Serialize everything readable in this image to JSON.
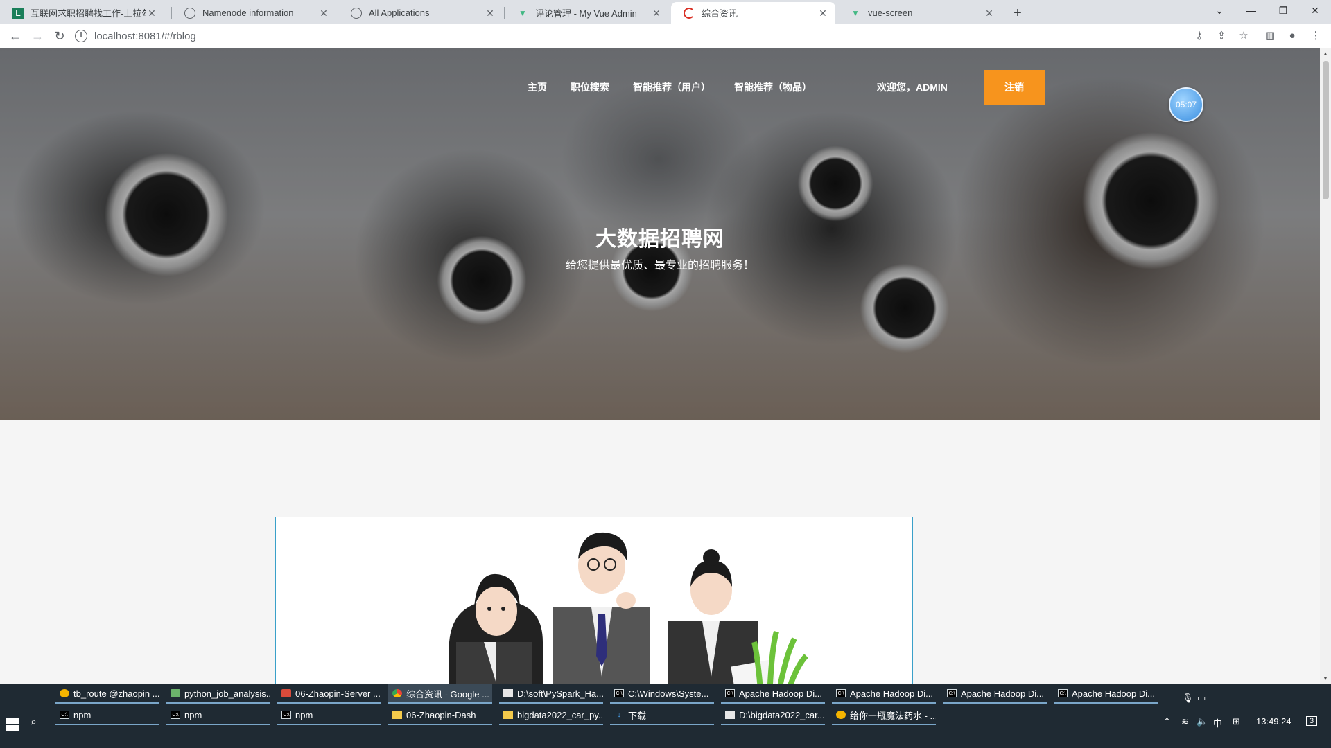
{
  "browser": {
    "tabs": [
      {
        "title": "互联网求职招聘找工作-上拉勾招",
        "favicon": "L",
        "active": false
      },
      {
        "title": "Namenode information",
        "favicon": "globe",
        "active": false
      },
      {
        "title": "All Applications",
        "favicon": "globe",
        "active": false
      },
      {
        "title": "评论管理 - My Vue Admin",
        "favicon": "vue",
        "active": false
      },
      {
        "title": "综合资讯",
        "favicon": "loading",
        "active": true
      },
      {
        "title": "vue-screen",
        "favicon": "vue",
        "active": false
      }
    ],
    "url": "localhost:8081/#/rblog"
  },
  "nav": {
    "links": [
      "主页",
      "职位搜索",
      "智能推荐（用户）",
      "智能推荐（物品）"
    ],
    "welcome": "欢迎您，ADMIN",
    "logout": "注销"
  },
  "hero": {
    "title": "大数据招聘网",
    "subtitle": "给您提供最优质、最专业的招聘服务！"
  },
  "timer": "05:07",
  "taskbar": {
    "row1": [
      {
        "label": "tb_route @zhaopin ...",
        "icon": "bulb-icon"
      },
      {
        "label": "python_job_analysis...",
        "icon": "python-icon"
      },
      {
        "label": "06-Zhaopin-Server ...",
        "icon": "app-icon"
      },
      {
        "label": "综合资讯 - Google ...",
        "icon": "chrome-icon"
      },
      {
        "label": "D:\\soft\\PySpark_Ha...",
        "icon": "doc-icon"
      },
      {
        "label": "C:\\Windows\\Syste...",
        "icon": "cmd-icon"
      },
      {
        "label": "Apache Hadoop Di...",
        "icon": "cmd-icon"
      },
      {
        "label": "Apache Hadoop Di...",
        "icon": "cmd-icon"
      },
      {
        "label": "Apache Hadoop Di...",
        "icon": "cmd-icon"
      },
      {
        "label": "Apache Hadoop Di...",
        "icon": "cmd-icon"
      }
    ],
    "row2": [
      {
        "label": "npm",
        "icon": "cmd-icon"
      },
      {
        "label": "npm",
        "icon": "cmd-icon"
      },
      {
        "label": "npm",
        "icon": "cmd-icon"
      },
      {
        "label": "06-Zhaopin-Dash",
        "icon": "folder-icon"
      },
      {
        "label": "bigdata2022_car_py...",
        "icon": "folder-icon"
      },
      {
        "label": "下载",
        "icon": "download-icon"
      },
      {
        "label": "D:\\bigdata2022_car...",
        "icon": "app-icon"
      },
      {
        "label": "给你一瓶魔法药水 - ...",
        "icon": "bulb-icon"
      }
    ],
    "tray": {
      "ime": "中",
      "time": "13:49:24",
      "notifications": "3"
    }
  },
  "colors": {
    "accent": "#f7941d",
    "card_border": "#3aa0c9",
    "taskbar": "#1f2a33"
  }
}
